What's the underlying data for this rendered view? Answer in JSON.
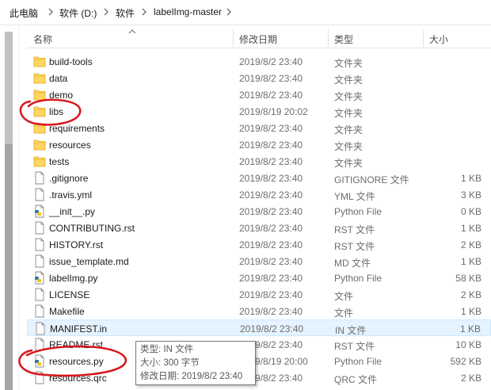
{
  "breadcrumb": [
    "此电脑",
    "软件 (D:)",
    "软件",
    "labelImg-master"
  ],
  "columns": {
    "name": "名称",
    "date": "修改日期",
    "type": "类型",
    "size": "大小"
  },
  "files": [
    {
      "name": "build-tools",
      "date": "2019/8/2 23:40",
      "type": "文件夹",
      "size": "",
      "icon": "folder-icon"
    },
    {
      "name": "data",
      "date": "2019/8/2 23:40",
      "type": "文件夹",
      "size": "",
      "icon": "folder-icon"
    },
    {
      "name": "demo",
      "date": "2019/8/2 23:40",
      "type": "文件夹",
      "size": "",
      "icon": "folder-icon"
    },
    {
      "name": "libs",
      "date": "2019/8/19 20:02",
      "type": "文件夹",
      "size": "",
      "icon": "folder-icon"
    },
    {
      "name": "requirements",
      "date": "2019/8/2 23:40",
      "type": "文件夹",
      "size": "",
      "icon": "folder-icon"
    },
    {
      "name": "resources",
      "date": "2019/8/2 23:40",
      "type": "文件夹",
      "size": "",
      "icon": "folder-icon"
    },
    {
      "name": "tests",
      "date": "2019/8/2 23:40",
      "type": "文件夹",
      "size": "",
      "icon": "folder-icon"
    },
    {
      "name": ".gitignore",
      "date": "2019/8/2 23:40",
      "type": "GITIGNORE 文件",
      "size": "1 KB",
      "icon": "file-icon"
    },
    {
      "name": ".travis.yml",
      "date": "2019/8/2 23:40",
      "type": "YML 文件",
      "size": "3 KB",
      "icon": "file-icon"
    },
    {
      "name": "__init__.py",
      "date": "2019/8/2 23:40",
      "type": "Python File",
      "size": "0 KB",
      "icon": "python-file-icon"
    },
    {
      "name": "CONTRIBUTING.rst",
      "date": "2019/8/2 23:40",
      "type": "RST 文件",
      "size": "1 KB",
      "icon": "file-icon"
    },
    {
      "name": "HISTORY.rst",
      "date": "2019/8/2 23:40",
      "type": "RST 文件",
      "size": "2 KB",
      "icon": "file-icon"
    },
    {
      "name": "issue_template.md",
      "date": "2019/8/2 23:40",
      "type": "MD 文件",
      "size": "1 KB",
      "icon": "file-icon"
    },
    {
      "name": "labelImg.py",
      "date": "2019/8/2 23:40",
      "type": "Python File",
      "size": "58 KB",
      "icon": "python-file-icon"
    },
    {
      "name": "LICENSE",
      "date": "2019/8/2 23:40",
      "type": "文件",
      "size": "2 KB",
      "icon": "file-icon"
    },
    {
      "name": "Makefile",
      "date": "2019/8/2 23:40",
      "type": "文件",
      "size": "1 KB",
      "icon": "file-icon"
    },
    {
      "name": "MANIFEST.in",
      "date": "2019/8/2 23:40",
      "type": "IN 文件",
      "size": "1 KB",
      "icon": "file-icon",
      "selected": true
    },
    {
      "name": "README.rst",
      "date": "2019/8/2 23:40",
      "type": "RST 文件",
      "size": "10 KB",
      "icon": "file-icon"
    },
    {
      "name": "resources.py",
      "date": "2019/8/19 20:00",
      "type": "Python File",
      "size": "592 KB",
      "icon": "python-file-icon"
    },
    {
      "name": "resources.qrc",
      "date": "2019/8/2 23:40",
      "type": "QRC 文件",
      "size": "2 KB",
      "icon": "file-icon"
    }
  ],
  "tooltip": {
    "line1": "类型: IN 文件",
    "line2": "大小: 300 字节",
    "line3": "修改日期: 2019/8/2 23:40"
  },
  "colors": {
    "selection_bg": "#e5f3ff",
    "folder": "#ffd564",
    "annotation": "#d9161c"
  }
}
